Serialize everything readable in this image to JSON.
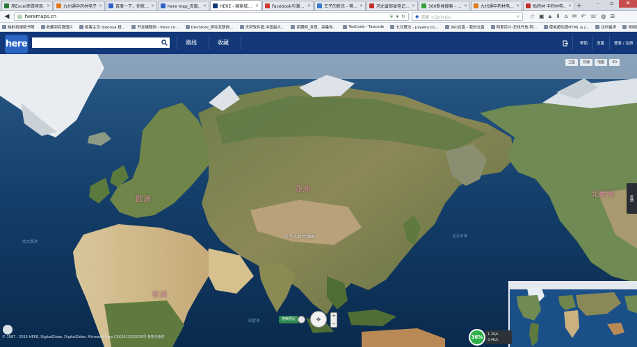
{
  "browser": {
    "tabs": [
      {
        "label": "用Excel来做项目…",
        "color": "#2a7a3a"
      },
      {
        "label": "九州通中药材电子商…",
        "color": "#e07a20"
      },
      {
        "label": "百度一下，你就…",
        "color": "#2f62c7"
      },
      {
        "label": "here map_百度…",
        "color": "#2f62c7"
      },
      {
        "label": "HERE - 国家城…",
        "color": "#12387a",
        "active": true
      },
      {
        "label": "Facebook与潮…",
        "color": "#d33a2f"
      },
      {
        "label": "王子的新衣 - 蒂…",
        "color": "#3a7ad0"
      },
      {
        "label": "河北省邮省电记…",
        "color": "#c22f2f"
      },
      {
        "label": "360新闻搜索 - …",
        "color": "#3aa13a"
      },
      {
        "label": "九州通中药材电…",
        "color": "#e07a20"
      },
      {
        "label": "贴药材 中药材电…",
        "color": "#c22f2f"
      }
    ],
    "url": "heremaps.cn",
    "search_placeholder": "百度 <Ctrl+K>",
    "bookmarks": [
      "映射到搜狐书照",
      "收藏到百度图片",
      "极客主页 iboonya 极…",
      "开发编程网 - ifeve.co…",
      "DevStore_移动互联网…",
      "天府软件园,中国最大…",
      "花瓣网_发现、采集你…",
      "TaoCode - Taocode",
      "七月算法 - julyedu.co…",
      "360云盘 - 我的云盘",
      "阿里百川-无线开放-阿…",
      "使用超动感HTML & J…",
      "访问最多",
      "常用网址"
    ]
  },
  "here": {
    "logo": "here",
    "search_placeholder": "",
    "nav": {
      "route": "路线",
      "favorites": "收藏"
    },
    "right": {
      "help": "帮助",
      "settings": "设置",
      "login": "登录 / 注册"
    }
  },
  "map": {
    "layers": [
      "卫星",
      "交通",
      "地图",
      "3D"
    ],
    "labels": {
      "europe": "欧洲",
      "asia": "亚洲",
      "north_america": "北美洲",
      "africa": "非洲",
      "china": "中华人民共和国",
      "atlantic": "北大西洋",
      "pacific": "北太平洋",
      "indian": "印度洋"
    },
    "side_tab": "反馈",
    "nav_pill": "搜索附近",
    "copyright": "© 1987 - 2015 HERE, DigitalGlobe, DigitalGlobe, Microsoft Corp CSI(2012)GS026号 条款与条件",
    "battery": "36%",
    "net_up": "1.2K/s",
    "net_down": "3.4K/s"
  }
}
